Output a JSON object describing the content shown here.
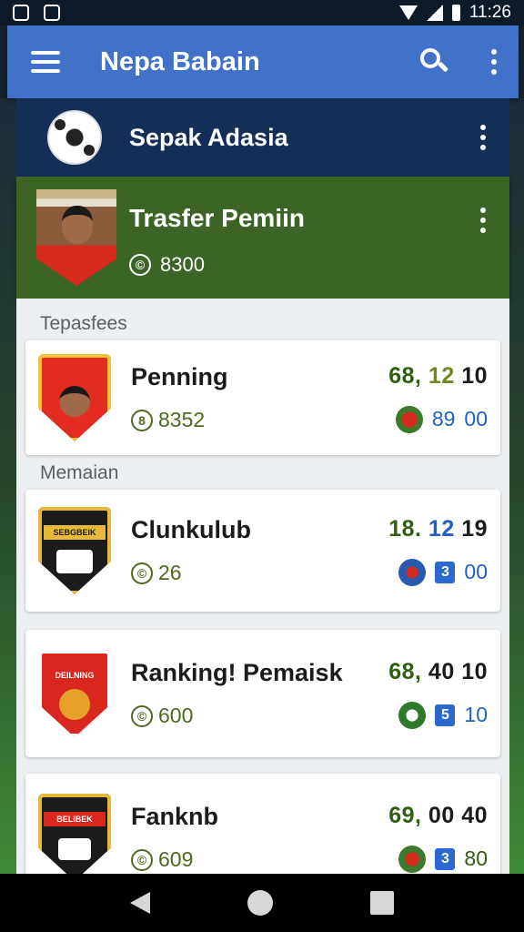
{
  "status_bar": {
    "time": "11:26"
  },
  "app_bar": {
    "title": "Nepa Babain"
  },
  "league": {
    "title": "Sepak Adasia"
  },
  "transfer": {
    "title": "Trasfer Pemiin",
    "stat": "8300",
    "stat_symbol": "©"
  },
  "sections": {
    "first": "Tepasfees",
    "second": "Memaian"
  },
  "rows": [
    {
      "name": "Penning",
      "coin": "8",
      "sub": "8352",
      "stat_a": "68,",
      "stat_b": "12",
      "stat_c": "10",
      "stat_d": "89",
      "stat_e": "00",
      "crest_text": "",
      "badge": ""
    },
    {
      "name": "Clunkulub",
      "coin": "©",
      "sub": "26",
      "stat_a": "18.",
      "stat_b": "12",
      "stat_c": "19",
      "stat_d": "3",
      "stat_e": "00",
      "crest_text": "SEBGBEIK",
      "badge": "3"
    },
    {
      "name": "Ranking! Pemaisk",
      "coin": "©",
      "sub": "600",
      "stat_a": "68,",
      "stat_b": "40",
      "stat_c": "10",
      "stat_d": "5",
      "stat_e": "10",
      "crest_text": "DEILNING",
      "badge": "5"
    },
    {
      "name": "Fanknb",
      "coin": "©",
      "sub": "609",
      "stat_a": "69,",
      "stat_b": "00",
      "stat_c": "40",
      "stat_d": "3",
      "stat_e": "80",
      "crest_text": "BELIBEK",
      "badge": "3"
    }
  ],
  "colors": {
    "app_bar": "#3f72c8",
    "league_bar": "#142e58",
    "transfer_card": "#3c6425",
    "accent_blue": "#2062c2",
    "accent_green": "#2e5e12"
  },
  "icons": {
    "menu": "hamburger-icon",
    "search": "search-icon",
    "overflow": "more-vert-icon",
    "league": "soccer-ball-icon",
    "coin": "coin-icon",
    "nav_back": "back-icon",
    "nav_home": "home-icon",
    "nav_recent": "recent-apps-icon"
  }
}
